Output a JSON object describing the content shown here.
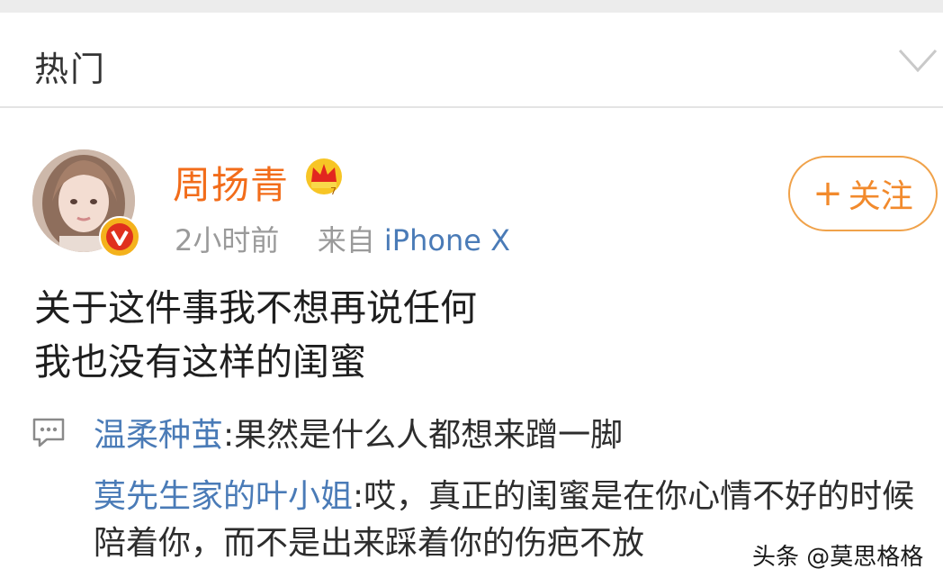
{
  "header": {
    "title": "热门",
    "expand_icon": "chevron-down-icon"
  },
  "post": {
    "author": "周扬青",
    "badge_icon": "crown-icon",
    "verified_icon": "verified-v-icon",
    "time": "2小时前",
    "source_prefix": "来自",
    "source": "iPhone X",
    "follow_plus": "+",
    "follow_label": "关注",
    "lines": [
      "关于这件事我不想再说任何",
      "我也没有这样的闺蜜"
    ]
  },
  "comments": [
    {
      "nick": "温柔种茧",
      "text": ":果然是什么人都想来蹭一脚"
    },
    {
      "nick": "莫先生家的叶小姐",
      "text": ":哎，真正的闺蜜是在你心情不好的时候陪着你，而不是出来踩着你的伤疤不放"
    }
  ],
  "watermark": "头条 @莫思格格",
  "colors": {
    "accent_orange": "#f26c1a",
    "link_blue": "#4a7bb7",
    "meta_gray": "#9a9a9a"
  }
}
